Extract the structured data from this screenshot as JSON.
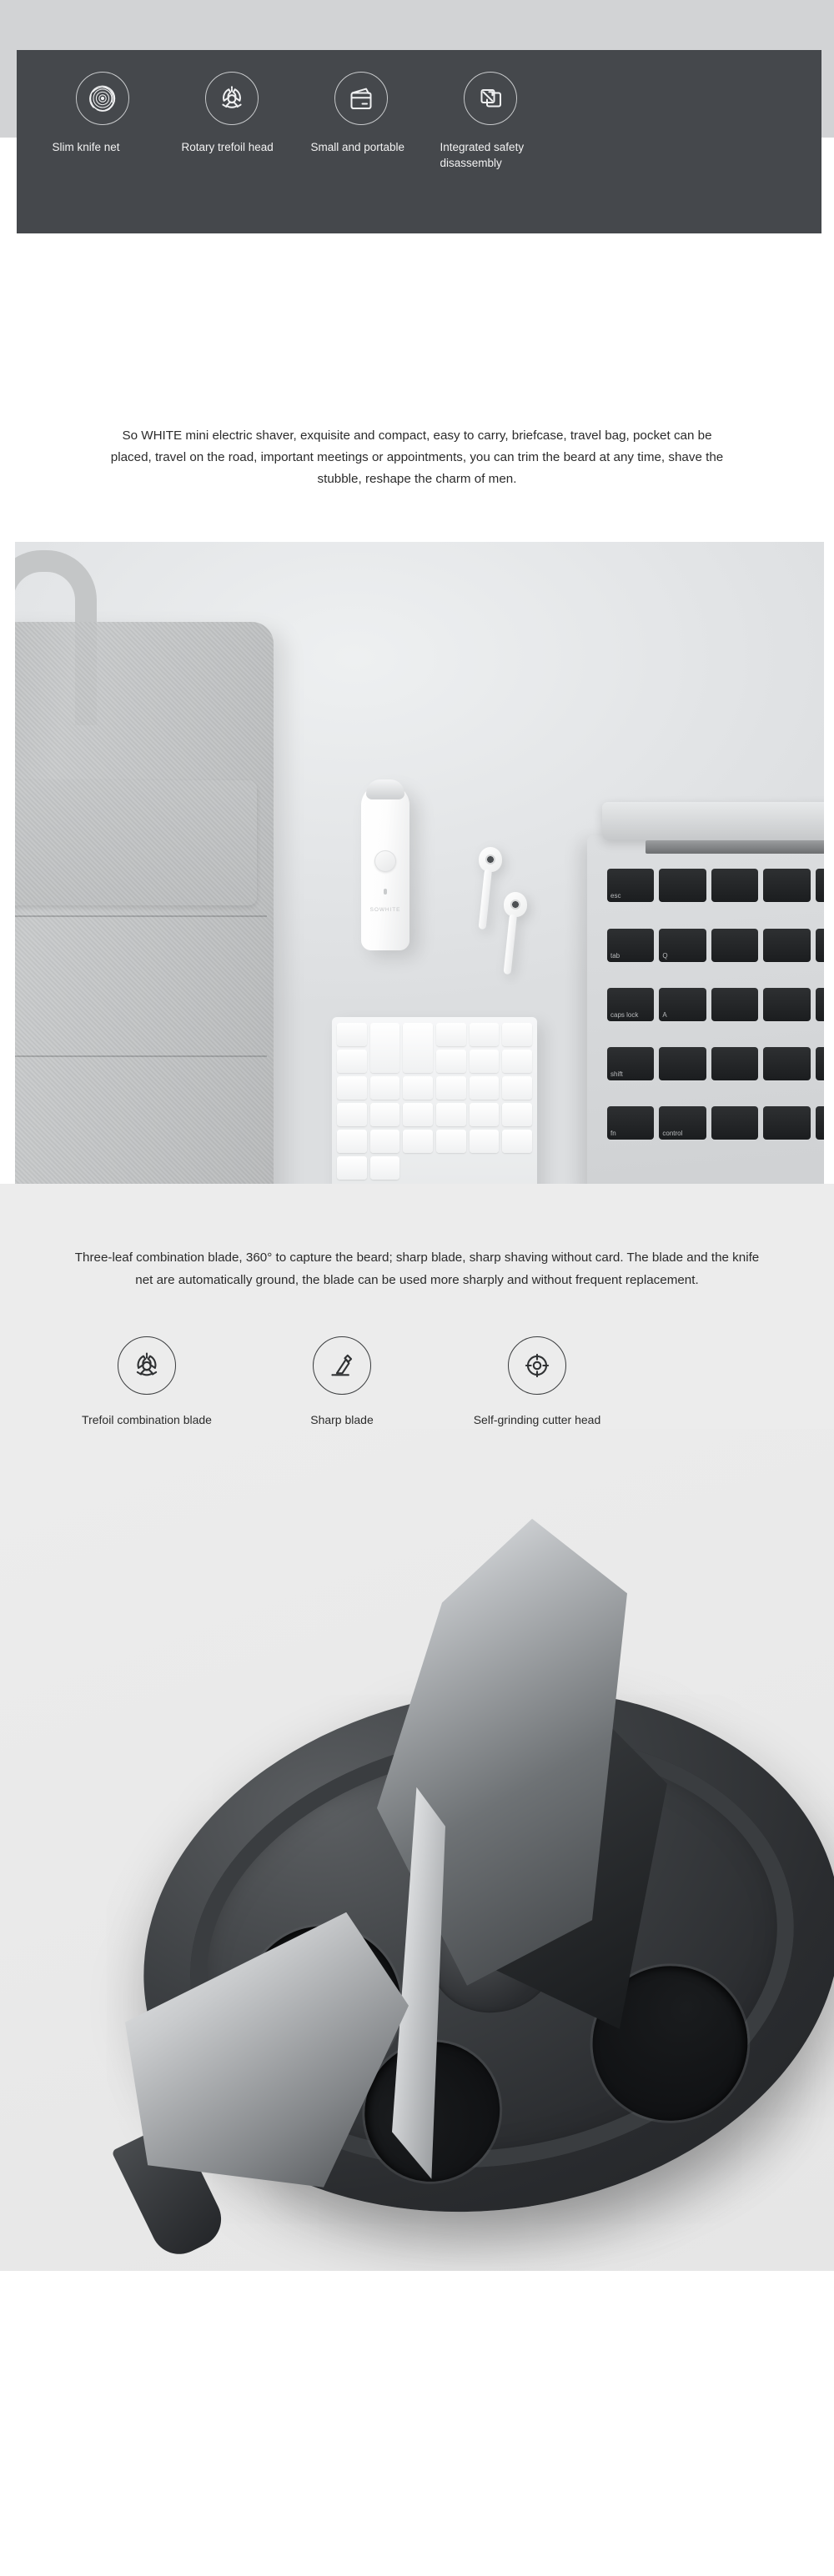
{
  "hero": {
    "features": [
      {
        "label": "Slim knife net",
        "icon": "knife-net-icon"
      },
      {
        "label": "Rotary trefoil head",
        "icon": "trefoil-head-icon"
      },
      {
        "label": "Small and portable",
        "icon": "wallet-icon"
      },
      {
        "label": "Integrated safety disassembly",
        "icon": "disassembly-icon"
      }
    ]
  },
  "intro": {
    "paragraph": "So WHITE mini electric shaver, exquisite and compact, easy to carry, briefcase, travel bag, pocket can be placed, travel on the road, important meetings or appointments, you can trim the beard at any time, shave the stubble, reshape the charm of men."
  },
  "photo": {
    "brand_text": "SOWHITE",
    "mac_keys": [
      "esc",
      "",
      "",
      "",
      "",
      "tab",
      "Q",
      "",
      "",
      "",
      "caps lock",
      "A",
      "",
      "",
      "",
      "shift",
      "",
      "",
      "",
      "",
      "fn",
      "control",
      "",
      "",
      ""
    ]
  },
  "blade_section": {
    "paragraph": "Three-leaf combination blade, 360° to capture the beard; sharp blade, sharp shaving without card. The blade and the knife net are automatically ground, the blade can be used more sharply and without frequent replacement.",
    "features": [
      {
        "label": "Trefoil combination blade",
        "icon": "trefoil-head-icon"
      },
      {
        "label": "Sharp blade",
        "icon": "sharp-blade-icon"
      },
      {
        "label": "Self-grinding cutter head",
        "icon": "self-grinding-target-icon"
      }
    ]
  },
  "colors": {
    "panel_dark": "#45484c",
    "top_bar_grey": "#d2d3d5",
    "section_grey": "#ececec",
    "text_dark": "#2b2b2b",
    "text_light": "#f2f2f2"
  }
}
